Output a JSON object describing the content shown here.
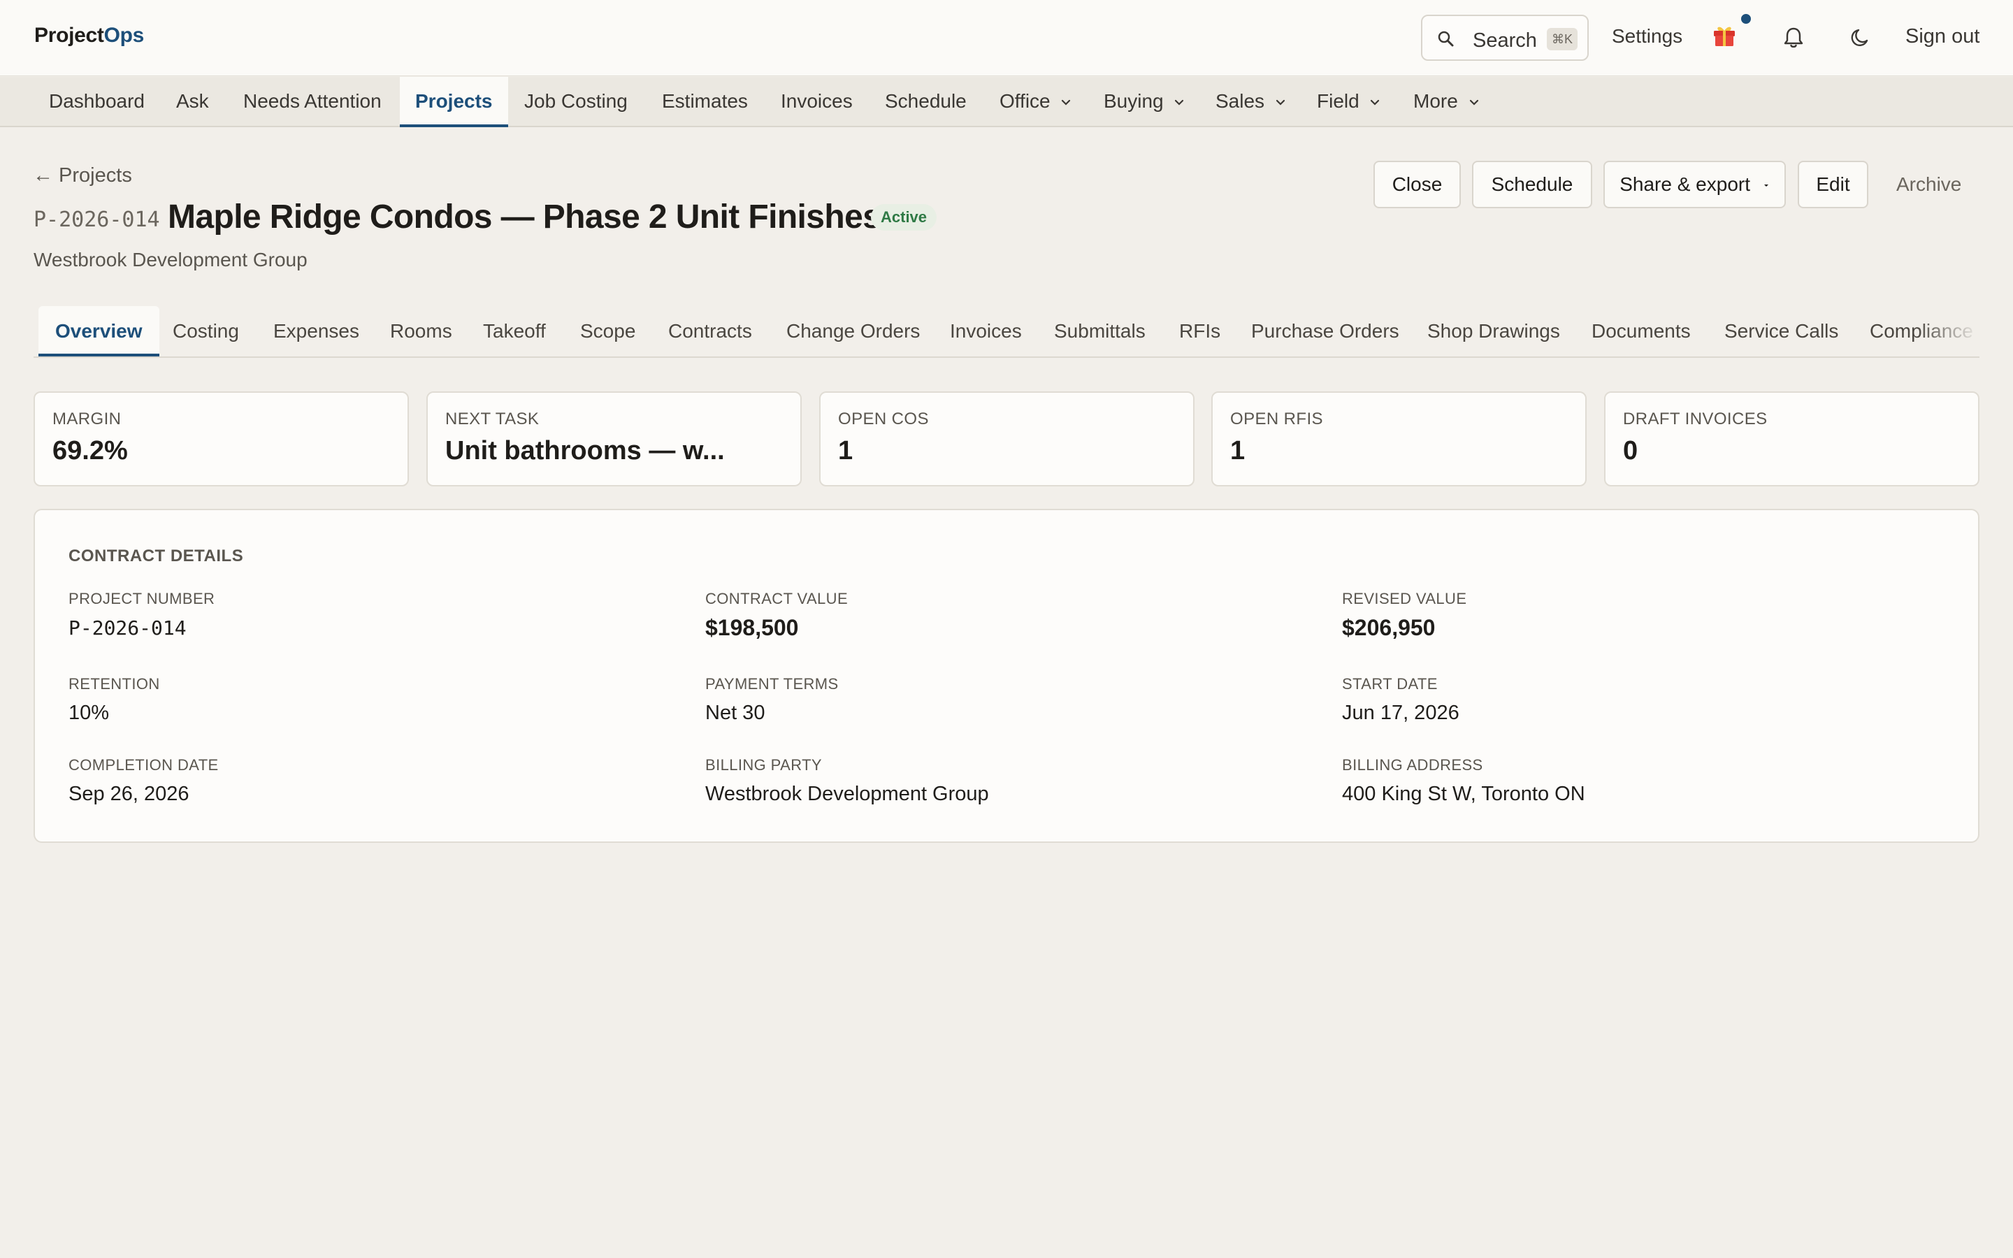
{
  "app": {
    "logo_part1": "Project",
    "logo_part2": "Ops"
  },
  "topbar": {
    "search_label": "Search",
    "search_shortcut": "⌘K",
    "settings": "Settings",
    "sign_out": "Sign out"
  },
  "nav": {
    "items": [
      "Dashboard",
      "Ask",
      "Needs Attention",
      "Projects",
      "Job Costing",
      "Estimates",
      "Invoices",
      "Schedule",
      "Office",
      "Buying",
      "Sales",
      "Field",
      "More"
    ],
    "active": "Projects"
  },
  "header": {
    "back": "← Projects",
    "project_number": "P-2026-014",
    "title": "Maple Ridge Condos — Phase 2 Unit Finishes",
    "status": "Active",
    "client": "Westbrook Development Group"
  },
  "actions": {
    "close": "Close",
    "schedule": "Schedule",
    "share_export": "Share & export",
    "edit": "Edit",
    "archive": "Archive"
  },
  "tabs": [
    "Overview",
    "Costing",
    "Expenses",
    "Rooms",
    "Takeoff",
    "Scope",
    "Contracts",
    "Change Orders",
    "Invoices",
    "Submittals",
    "RFIs",
    "Purchase Orders",
    "Shop Drawings",
    "Documents",
    "Service Calls",
    "Compliance"
  ],
  "kpis": [
    {
      "label": "MARGIN",
      "value": "69.2%"
    },
    {
      "label": "NEXT TASK",
      "value": "Unit bathrooms — w..."
    },
    {
      "label": "OPEN COS",
      "value": "1"
    },
    {
      "label": "OPEN RFIS",
      "value": "1"
    },
    {
      "label": "DRAFT INVOICES",
      "value": "0"
    }
  ],
  "contract": {
    "title": "CONTRACT DETAILS",
    "project_number_label": "PROJECT NUMBER",
    "project_number": "P-2026-014",
    "contract_value_label": "CONTRACT VALUE",
    "contract_value": "$198,500",
    "revised_value_label": "REVISED VALUE",
    "revised_value": "$206,950",
    "retention_label": "RETENTION",
    "retention": "10%",
    "payment_terms_label": "PAYMENT TERMS",
    "payment_terms": "Net 30",
    "start_date_label": "START DATE",
    "start_date": "Jun 17, 2026",
    "completion_date_label": "COMPLETION DATE",
    "completion_date": "Sep 26, 2026",
    "billing_party_label": "BILLING PARTY",
    "billing_party": "Westbrook Development Group",
    "billing_address_label": "BILLING ADDRESS",
    "billing_address": "400 King St W, Toronto ON"
  },
  "colors": {
    "accent": "#1d4f7a",
    "status_active": "#2f7a45",
    "background": "#f2efea"
  }
}
